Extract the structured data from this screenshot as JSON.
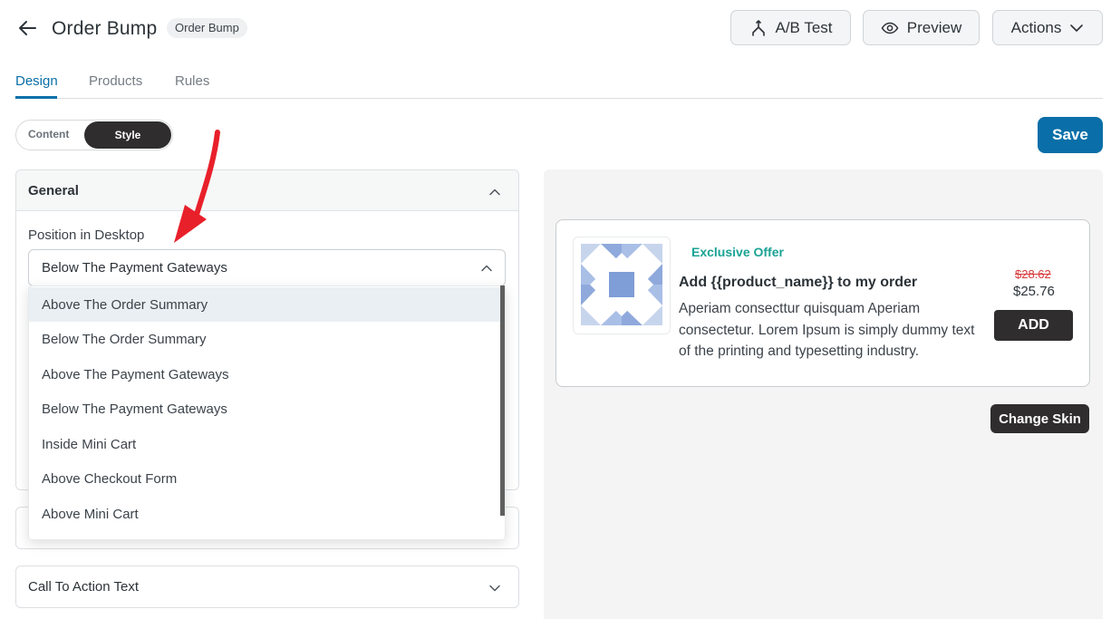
{
  "header": {
    "title": "Order Bump",
    "badge": "Order Bump",
    "ab_test_label": "A/B Test",
    "preview_label": "Preview",
    "actions_label": "Actions"
  },
  "tabs": [
    {
      "label": "Design",
      "active": true
    },
    {
      "label": "Products",
      "active": false
    },
    {
      "label": "Rules",
      "active": false
    }
  ],
  "mode_toggle": {
    "content_label": "Content",
    "style_label": "Style",
    "selected": "Style"
  },
  "save_label": "Save",
  "general": {
    "title": "General",
    "position_label": "Position in Desktop",
    "position_value": "Below The Payment Gateways",
    "options": [
      "Above The Order Summary",
      "Below The Order Summary",
      "Above The Payment Gateways",
      "Below The Payment Gateways",
      "Inside Mini Cart",
      "Above Checkout Form",
      "Above Mini Cart"
    ],
    "highlighted_option": "Above The Order Summary"
  },
  "cta_panel": {
    "title": "Call To Action Text"
  },
  "preview": {
    "exclusive_label": "Exclusive Offer",
    "title": "Add {{product_name}} to my order",
    "description": "Aperiam consecttur quisquam Aperiam consectetur. Lorem Ipsum is simply dummy text of the printing and typesetting industry.",
    "old_price": "$28.62",
    "new_price": "$25.76",
    "add_label": "ADD",
    "change_skin_label": "Change Skin"
  },
  "colors": {
    "accent": "#0a6fa8",
    "dark_button": "#2f2d2d",
    "exclusive": "#1aa394",
    "old_price": "#d63638",
    "annotation_arrow": "#e8202a"
  }
}
